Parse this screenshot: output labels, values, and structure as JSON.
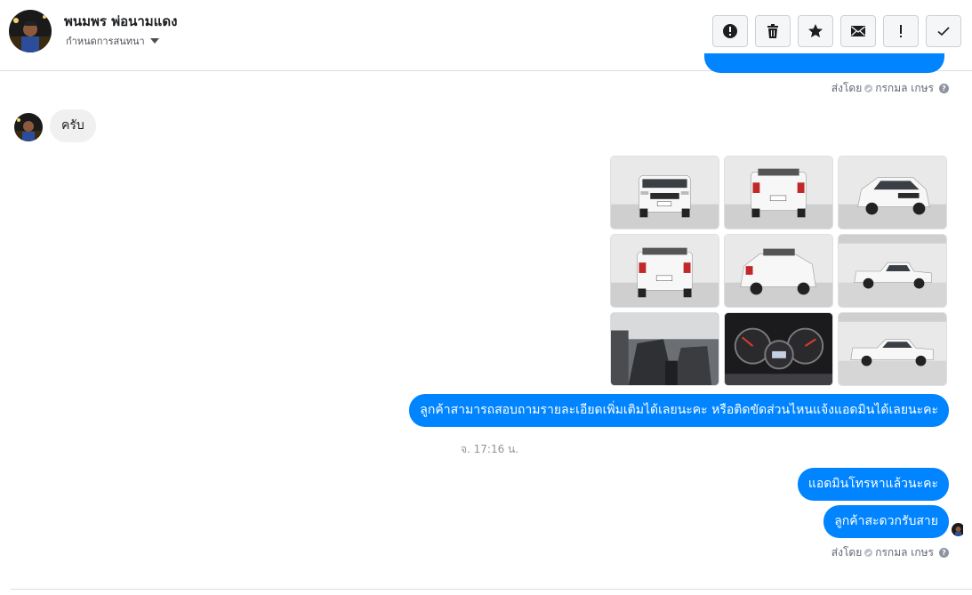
{
  "header": {
    "contact_name": "พนมพร พ่อนามแดง",
    "assign_label": "กำหนดการสนทนา",
    "actions": [
      {
        "name": "mark-spam-button",
        "icon": "alert-circle-icon"
      },
      {
        "name": "delete-button",
        "icon": "trash-icon"
      },
      {
        "name": "star-button",
        "icon": "star-icon"
      },
      {
        "name": "mark-unread-button",
        "icon": "envelope-icon"
      },
      {
        "name": "follow-up-button",
        "icon": "exclamation-icon"
      },
      {
        "name": "mark-done-button",
        "icon": "check-icon"
      }
    ]
  },
  "messages": {
    "sent_by_label_1": "ส่งโดย",
    "sender_name_1": "กรกมล เกษร",
    "incoming_text": "ครับ",
    "photo_count": 9,
    "info_message": "ลูกค้าสามารถสอบถามรายละเอียดเพิ่มเติมได้เลยนะคะ หรือติดขัดส่วนไหนแจ้งแอดมินได้เลยนะคะ",
    "timestamp": "จ. 17:16 น.",
    "out_message_1": "แอดมินโทรหาแล้วนะคะ",
    "out_message_2": "ลูกค้าสะดวกรับสาย",
    "sent_by_label_2": "ส่งโดย",
    "sender_name_2": "กรกมล เกษร"
  },
  "colors": {
    "bubble_out": "#0084ff",
    "bubble_in": "#f1f0f0",
    "truck": "#f4f4f4"
  }
}
